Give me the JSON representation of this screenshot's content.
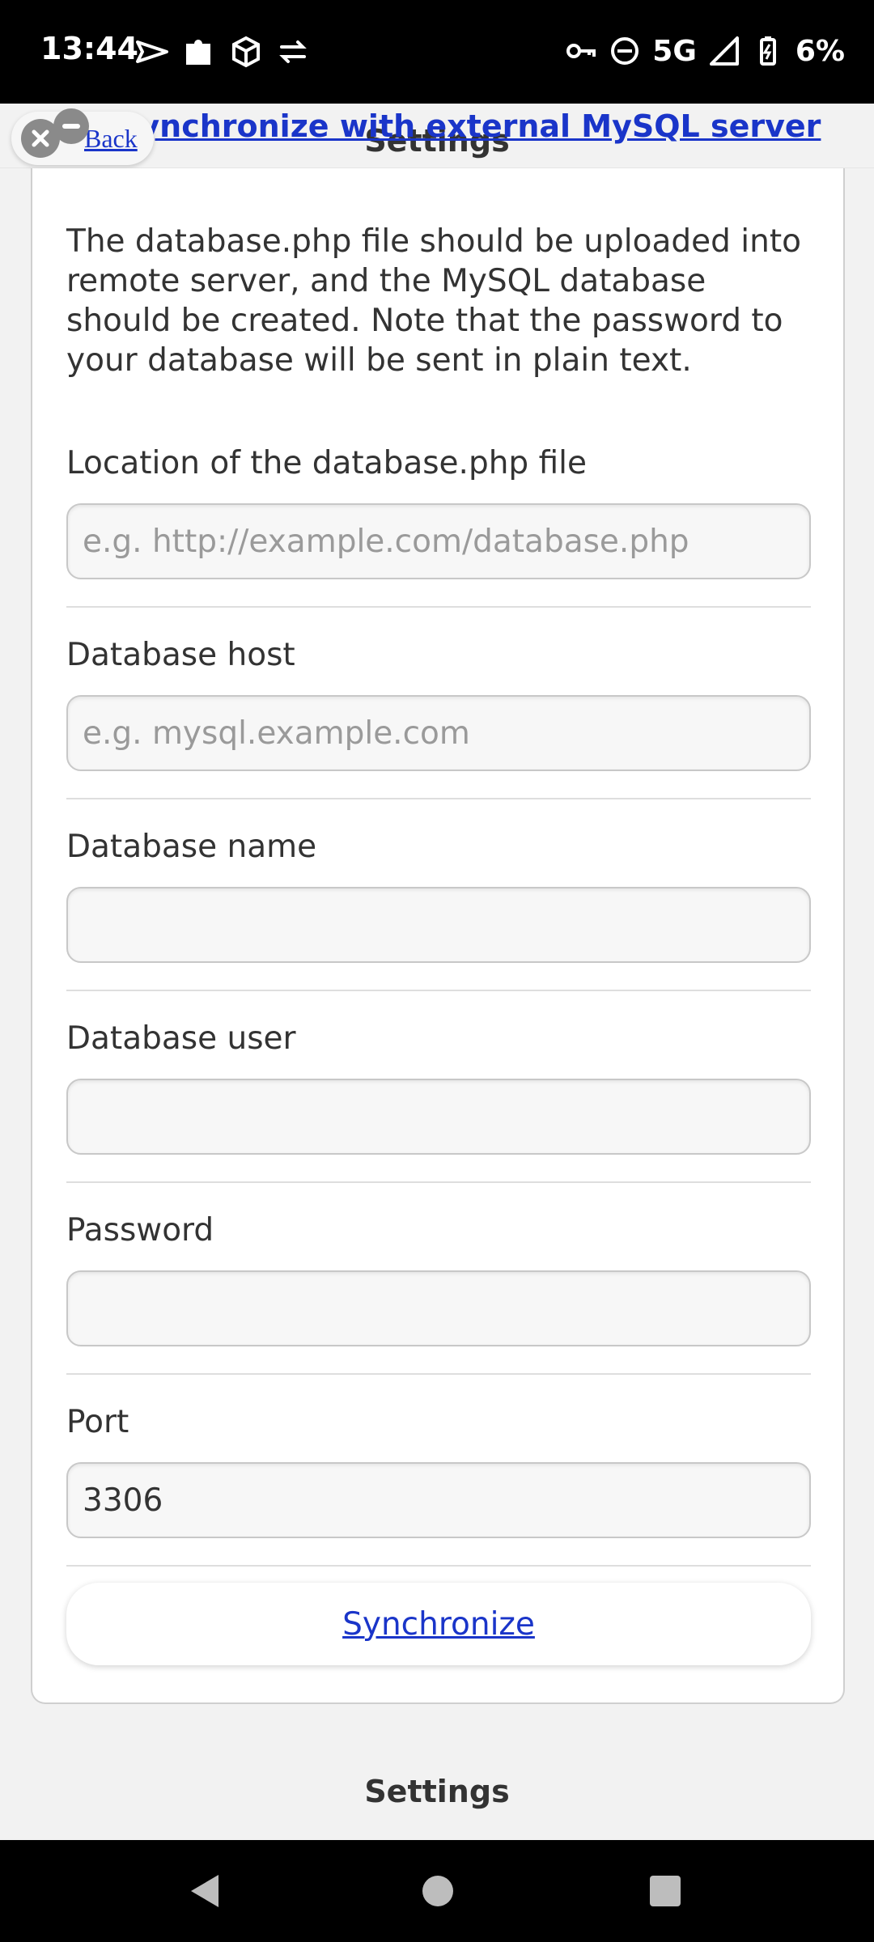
{
  "status_bar": {
    "time": "13:44",
    "network": "5G",
    "battery": "6%",
    "icons_left": [
      "send-icon",
      "puzzle-icon",
      "box-icon",
      "swap-icon"
    ],
    "icons_right": [
      "vpn-key-icon",
      "dnd-icon",
      "signal-icon",
      "battery-charging-icon"
    ]
  },
  "header": {
    "title": "Settings",
    "link": "Synchronize with external MySQL server",
    "back_label": "Back"
  },
  "main": {
    "intro": "The database.php file should be uploaded into remote server, and the MySQL database should be created. Note that the password to your database will be sent in plain text.",
    "fields": [
      {
        "label": "Location of the database.php file",
        "value": "",
        "placeholder": "e.g. http://example.com/database.php"
      },
      {
        "label": "Database host",
        "value": "",
        "placeholder": "e.g. mysql.example.com"
      },
      {
        "label": "Database name",
        "value": "",
        "placeholder": ""
      },
      {
        "label": "Database user",
        "value": "",
        "placeholder": ""
      },
      {
        "label": "Password",
        "value": "",
        "placeholder": ""
      },
      {
        "label": "Port",
        "value": "3306",
        "placeholder": ""
      }
    ],
    "sync_button": "Synchronize"
  },
  "footer": {
    "title": "Settings"
  },
  "colors": {
    "link": "#1a35c9",
    "background": "#f2f2f2",
    "card": "#ffffff"
  }
}
